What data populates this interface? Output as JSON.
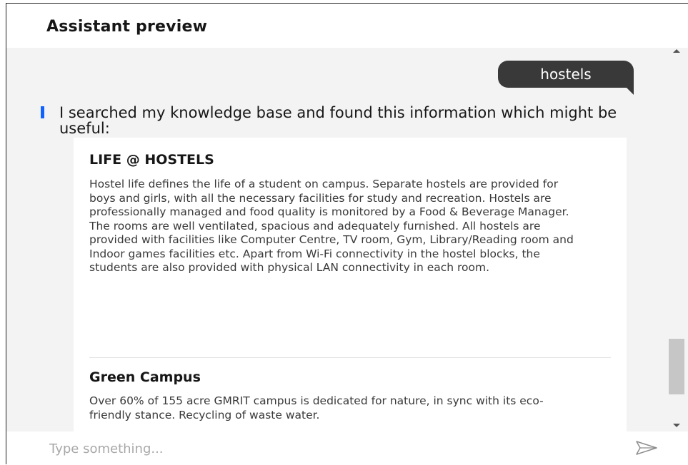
{
  "header": {
    "title": "Assistant preview"
  },
  "user_message": "hostels",
  "bot": {
    "intro": "I searched my knowledge base and found this information which might be useful:",
    "sections": [
      {
        "title": "LIFE @ HOSTELS",
        "body": "Hostel life defines the life of a student on campus. Separate hostels are provided for boys and girls, with all the necessary facilities for study and recreation. Hostels are professionally managed and food quality is monitored by a Food & Beverage Manager. The rooms are well ventilated, spacious and adequately furnished. All hostels are provided with facilities like Computer Centre, TV room, Gym, Library/Reading room and Indoor games facilities etc. Apart from Wi-Fi connectivity in the hostel blocks, the students are also provided with physical LAN connectivity in each room."
      },
      {
        "title": "Green Campus",
        "body": "Over 60% of 155 acre GMRIT campus is dedicated for nature, in sync with its eco-friendly stance. Recycling of waste water."
      }
    ]
  },
  "input": {
    "placeholder": "Type something..."
  },
  "icons": {
    "send": "send-icon",
    "scroll_up": "scroll-up-arrow-icon",
    "scroll_down": "scroll-down-arrow-icon",
    "marker": "bot-message-marker"
  },
  "colors": {
    "accent": "#0f62fe",
    "user_bubble": "#393939",
    "background": "#f3f3f3",
    "card": "#ffffff"
  }
}
